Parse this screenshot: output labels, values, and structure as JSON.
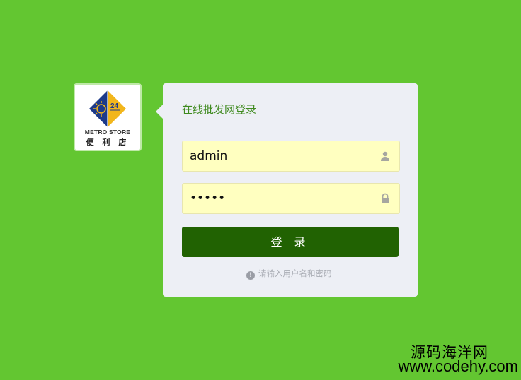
{
  "logo": {
    "badge_number": "24",
    "brand_en": "METRO STORE",
    "brand_cn": "便 利 店",
    "colors": {
      "blue": "#1d3a8a",
      "yellow": "#f2b61c"
    }
  },
  "login": {
    "title": "在线批发网登录",
    "username": {
      "value": "admin",
      "icon": "user-icon"
    },
    "password": {
      "value": "•••••",
      "icon": "lock-icon"
    },
    "submit_label": "登 录",
    "hint_text": "请输入用户名和密码",
    "hint_icon": "exclamation-circle-icon"
  },
  "watermark": {
    "site_name": "源码海洋网",
    "url": "www.codehy.com"
  },
  "colors": {
    "background": "#63c631",
    "button": "#216202",
    "title": "#3f8a1f",
    "field_bg": "#ffffc0"
  }
}
